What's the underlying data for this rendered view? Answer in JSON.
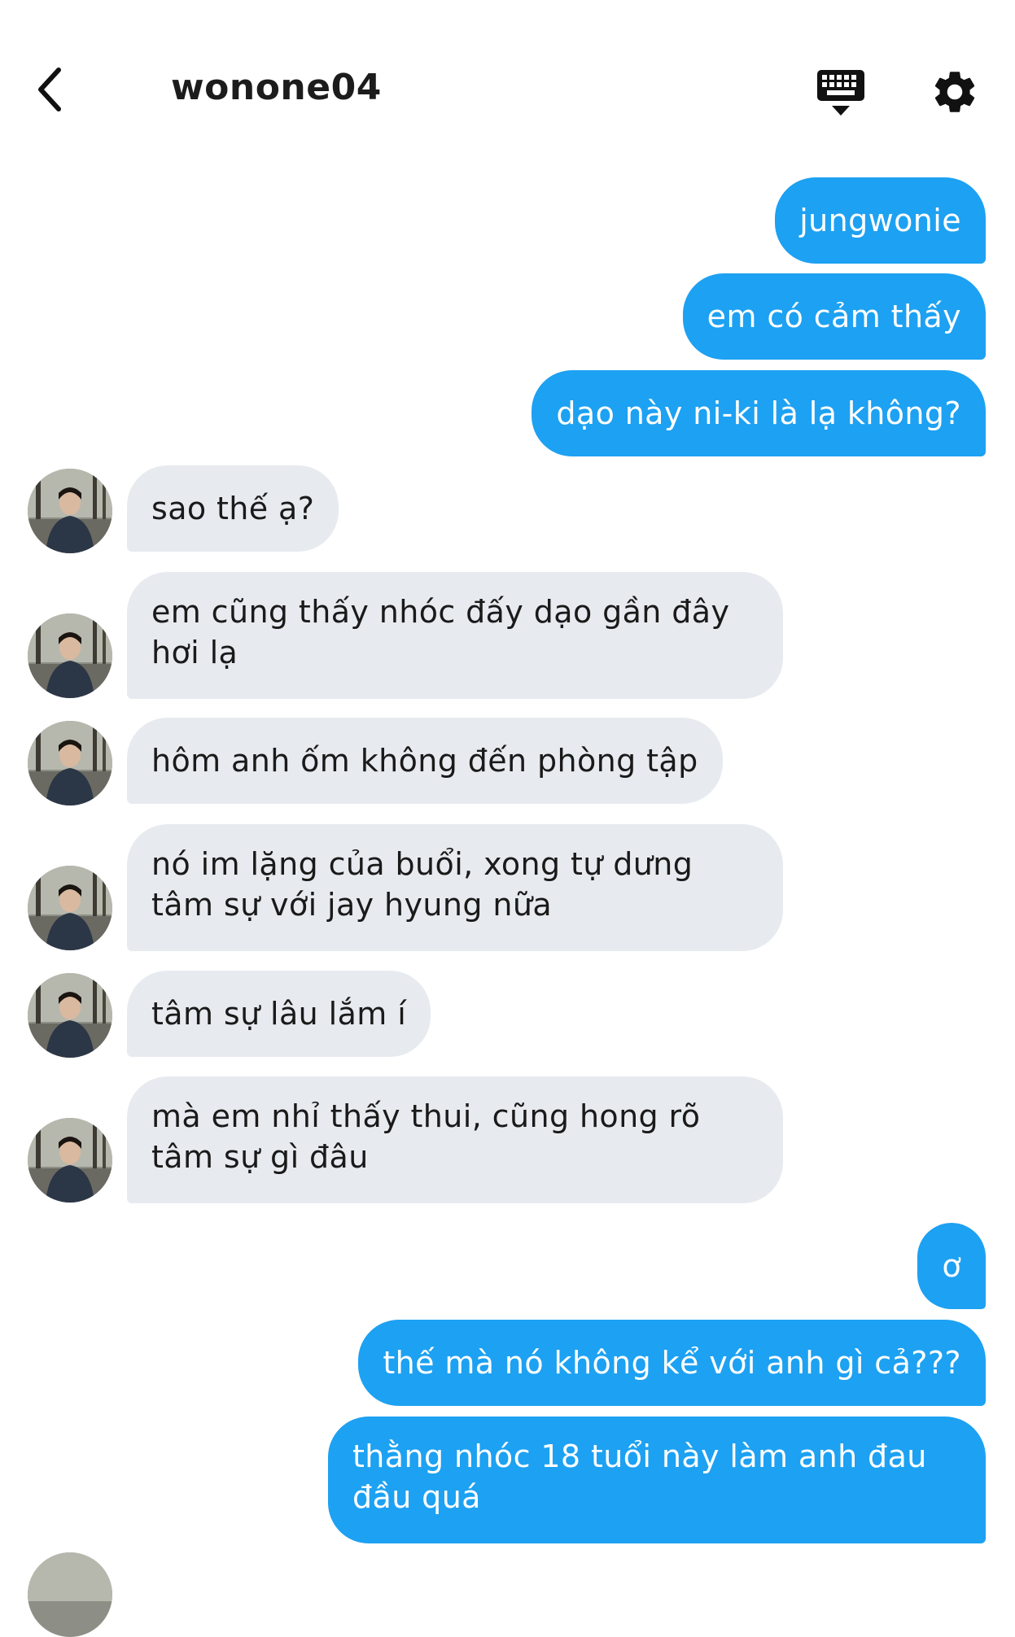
{
  "header": {
    "title": "wonone04",
    "back_icon": "chevron-left-icon",
    "keyboard_icon": "keyboard-icon",
    "settings_icon": "gear-icon"
  },
  "colors": {
    "outgoing_bubble": "#1da1f2",
    "incoming_bubble": "#e7ebef",
    "background": "#ffffff"
  },
  "messages": [
    {
      "direction": "out",
      "text": "jungwonie"
    },
    {
      "direction": "out",
      "text": "em có cảm thấy"
    },
    {
      "direction": "out",
      "text": "dạo này ni-ki là lạ không?"
    },
    {
      "direction": "in",
      "text": "sao thế ạ?"
    },
    {
      "direction": "in",
      "text": "em cũng thấy nhóc đấy dạo gần đây hơi lạ"
    },
    {
      "direction": "in",
      "text": "hôm anh ốm không đến phòng tập"
    },
    {
      "direction": "in",
      "text": "nó im lặng của buổi, xong tự dưng tâm sự với jay hyung nữa"
    },
    {
      "direction": "in",
      "text": "tâm sự lâu lắm í"
    },
    {
      "direction": "in",
      "text": "mà em nhỉ thấy thui, cũng hong rõ tâm sự gì đâu"
    },
    {
      "direction": "out",
      "text": "ơ"
    },
    {
      "direction": "out",
      "text": "thế mà nó không kể với anh gì cả???"
    },
    {
      "direction": "out",
      "text": "thằng nhóc 18 tuổi này làm anh đau đầu quá"
    }
  ]
}
